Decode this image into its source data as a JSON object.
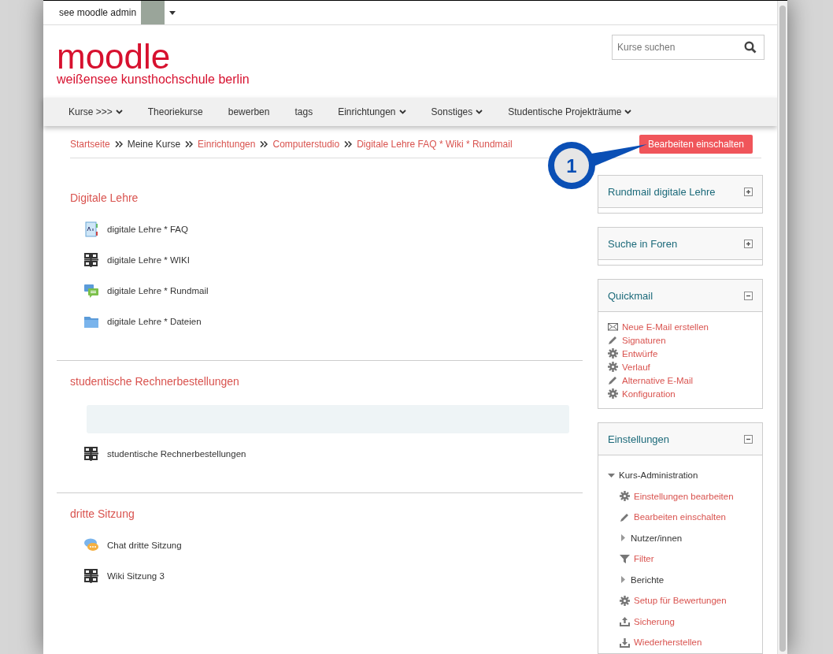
{
  "user_menu": {
    "name": "see moodle admin"
  },
  "logo": {
    "title": "moodle",
    "subtitle": "weißensee kunsthochschule berlin"
  },
  "search": {
    "placeholder": "Kurse suchen"
  },
  "nav": [
    {
      "label": "Kurse >>>",
      "has_menu": true
    },
    {
      "label": "Theoriekurse",
      "has_menu": false
    },
    {
      "label": "bewerben",
      "has_menu": false
    },
    {
      "label": "tags",
      "has_menu": false
    },
    {
      "label": "Einrichtungen",
      "has_menu": true
    },
    {
      "label": "Sonstiges",
      "has_menu": true
    },
    {
      "label": "Studentische Projekträume",
      "has_menu": true
    }
  ],
  "breadcrumb": [
    {
      "label": "Startseite",
      "link": true
    },
    {
      "label": "Meine Kurse",
      "link": false
    },
    {
      "label": "Einrichtungen",
      "link": true
    },
    {
      "label": "Computerstudio",
      "link": true
    },
    {
      "label": "Digitale Lehre FAQ * Wiki * Rundmail",
      "link": true
    }
  ],
  "edit_button": {
    "label": "Bearbeiten einschalten"
  },
  "callout": {
    "number": "1"
  },
  "sections": [
    {
      "title": "Digitale Lehre",
      "summary_box": false,
      "activities": [
        {
          "kind": "glossary",
          "label": "digitale Lehre * FAQ"
        },
        {
          "kind": "wiki",
          "label": "digitale Lehre * WIKI"
        },
        {
          "kind": "forum",
          "label": "digitale Lehre * Rundmail"
        },
        {
          "kind": "folder",
          "label": "digitale Lehre * Dateien"
        }
      ]
    },
    {
      "title": "studentische Rechnerbestellungen",
      "summary_box": true,
      "activities": [
        {
          "kind": "wiki",
          "label": "studentische Rechnerbestellungen"
        }
      ]
    },
    {
      "title": "dritte Sitzung",
      "summary_box": false,
      "activities": [
        {
          "kind": "chat",
          "label": "Chat dritte Sitzung"
        },
        {
          "kind": "wiki",
          "label": "Wiki Sitzung 3"
        }
      ]
    }
  ],
  "blocks": [
    {
      "title": "Rundmail digitale Lehre",
      "expanded": false
    },
    {
      "title": "Suche in Foren",
      "expanded": false
    },
    {
      "title": "Quickmail",
      "expanded": true,
      "links": [
        {
          "kind": "mail",
          "label": "Neue E-Mail erstellen"
        },
        {
          "kind": "pencil",
          "label": "Signaturen"
        },
        {
          "kind": "gear",
          "label": "Entwürfe"
        },
        {
          "kind": "gear",
          "label": "Verlauf"
        },
        {
          "kind": "pencil",
          "label": "Alternative E-Mail"
        },
        {
          "kind": "gear",
          "label": "Konfiguration"
        }
      ]
    },
    {
      "title": "Einstellungen",
      "expanded": true,
      "tree": [
        {
          "label": "Kurs-Administration",
          "expanded": true,
          "children": [
            {
              "kind": "gear",
              "label": "Einstellungen bearbeiten"
            },
            {
              "kind": "pencil",
              "label": "Bearbeiten einschalten"
            },
            {
              "kind": "branch",
              "label": "Nutzer/innen",
              "expanded": false
            },
            {
              "kind": "filter",
              "label": "Filter"
            },
            {
              "kind": "branch",
              "label": "Berichte",
              "expanded": false
            },
            {
              "kind": "gear",
              "label": "Setup für Bewertungen"
            },
            {
              "kind": "upload",
              "label": "Sicherung"
            },
            {
              "kind": "download",
              "label": "Wiederherstellen"
            }
          ]
        }
      ]
    }
  ]
}
